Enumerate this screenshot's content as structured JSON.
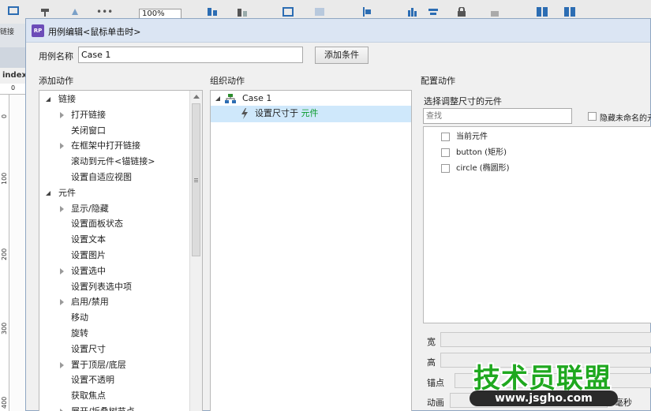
{
  "toolbar": {
    "zoom_value": "100%"
  },
  "left_strip": {
    "link_tab": "链接",
    "page_label": "index",
    "ruler_marks": [
      "0",
      "100",
      "200",
      "300",
      "400"
    ]
  },
  "dialog": {
    "title": "用例编辑<鼠标单击时>",
    "case_name_label": "用例名称",
    "case_name_value": "Case 1",
    "add_condition_button": "添加条件",
    "add_action_header": "添加动作",
    "organize_action_header": "组织动作",
    "configure_action_header": "配置动作",
    "action_tree": [
      {
        "label": "链接",
        "level": 0,
        "expander": "open"
      },
      {
        "label": "打开链接",
        "level": 1,
        "expander": "closed"
      },
      {
        "label": "关闭窗口",
        "level": 1,
        "expander": "none"
      },
      {
        "label": "在框架中打开链接",
        "level": 1,
        "expander": "closed"
      },
      {
        "label": "滚动到元件<锚链接>",
        "level": 1,
        "expander": "none"
      },
      {
        "label": "设置自适应视图",
        "level": 1,
        "expander": "none"
      },
      {
        "label": "元件",
        "level": 0,
        "expander": "open"
      },
      {
        "label": "显示/隐藏",
        "level": 1,
        "expander": "closed"
      },
      {
        "label": "设置面板状态",
        "level": 1,
        "expander": "none"
      },
      {
        "label": "设置文本",
        "level": 1,
        "expander": "none"
      },
      {
        "label": "设置图片",
        "level": 1,
        "expander": "none"
      },
      {
        "label": "设置选中",
        "level": 1,
        "expander": "closed"
      },
      {
        "label": "设置列表选中项",
        "level": 1,
        "expander": "none"
      },
      {
        "label": "启用/禁用",
        "level": 1,
        "expander": "closed"
      },
      {
        "label": "移动",
        "level": 1,
        "expander": "none"
      },
      {
        "label": "旋转",
        "level": 1,
        "expander": "none"
      },
      {
        "label": "设置尺寸",
        "level": 1,
        "expander": "none"
      },
      {
        "label": "置于顶层/底层",
        "level": 1,
        "expander": "closed"
      },
      {
        "label": "设置不透明",
        "level": 1,
        "expander": "none"
      },
      {
        "label": "获取焦点",
        "level": 1,
        "expander": "none"
      },
      {
        "label": "展开/折叠树节点",
        "level": 1,
        "expander": "closed"
      }
    ],
    "organize": {
      "case_label": "Case 1",
      "action_prefix": "设置尺寸于",
      "action_target": "元件"
    },
    "configure": {
      "select_label": "选择调整尺寸的元件",
      "search_placeholder": "查找",
      "hide_unnamed_label": "隐藏未命名的元",
      "widgets": [
        "当前元件",
        "button (矩形)",
        "circle (椭圆形)"
      ],
      "width_label": "宽",
      "height_label": "高",
      "anchor_label": "锚点",
      "animation_label": "动画",
      "ms_label": "毫秒"
    }
  },
  "watermark": {
    "title": "技术员联盟",
    "url": "www.jsgho.com"
  }
}
